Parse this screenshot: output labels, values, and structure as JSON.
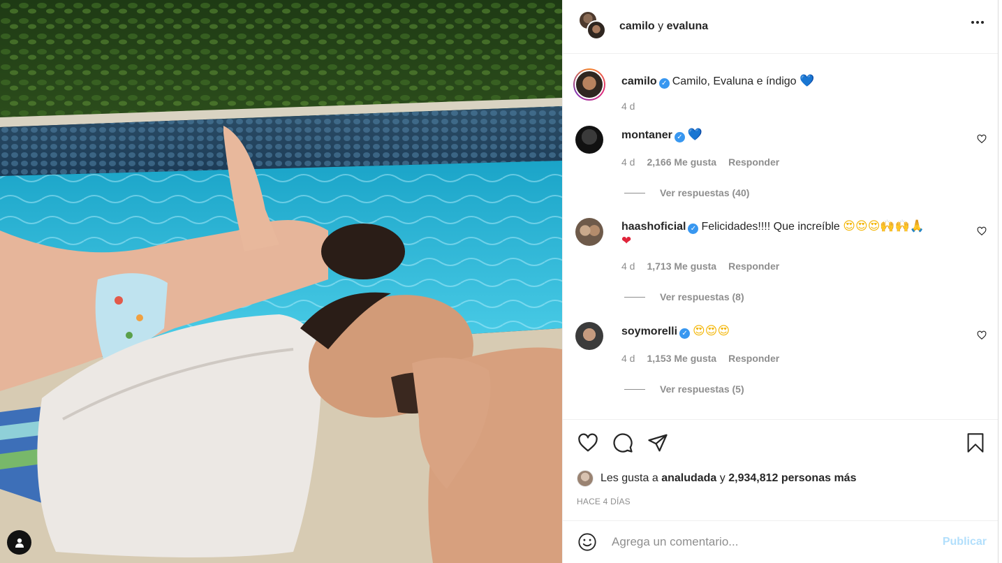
{
  "colors": {
    "link_blue": "#0095f6",
    "post_disabled": "#b2dffc",
    "muted_text": "#8e8e8e",
    "verified": "#3897f0"
  },
  "photo": {
    "description_icon": "user-tag-icon"
  },
  "header": {
    "user1": "camilo",
    "connector": "y",
    "user2": "evaluna",
    "more_icon": "more-options-icon"
  },
  "caption": {
    "username": "camilo",
    "text": "Camilo, Evaluna e índigo",
    "emoji": "💙",
    "time": "4 d"
  },
  "comments": [
    {
      "username": "montaner",
      "text": "",
      "emoji": "💙",
      "time": "4 d",
      "likes": "2,166 Me gusta",
      "reply": "Responder",
      "view_replies": "Ver respuestas (40)"
    },
    {
      "username": "haashoficial",
      "text": "Felicidades!!!! Que increíble",
      "emoji": "😍😍😍🙌🙌🙏",
      "emoji2": "❤",
      "time": "4 d",
      "likes": "1,713 Me gusta",
      "reply": "Responder",
      "view_replies": "Ver respuestas (8)"
    },
    {
      "username": "soymorelli",
      "text": "",
      "emoji": "😍😍😍",
      "time": "4 d",
      "likes": "1,153 Me gusta",
      "reply": "Responder",
      "view_replies": "Ver respuestas (5)"
    }
  ],
  "actions": {
    "icons": [
      "heart-icon",
      "comment-icon",
      "share-icon",
      "bookmark-icon"
    ],
    "likes_prefix": "Les gusta a",
    "liker": "analudada",
    "likes_connector": "y",
    "likes_count": "2,934,812 personas más",
    "time_ago": "HACE 4 DÍAS"
  },
  "add_comment": {
    "placeholder": "Agrega un comentario...",
    "post_label": "Publicar"
  }
}
